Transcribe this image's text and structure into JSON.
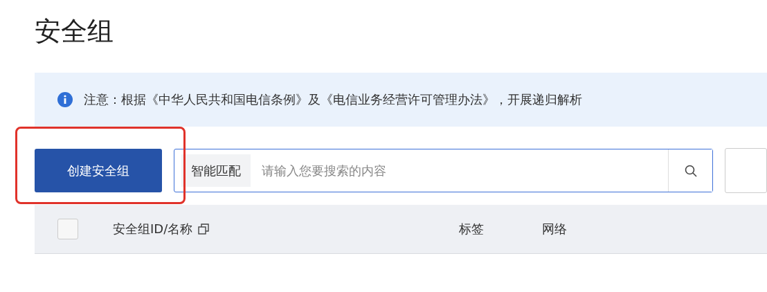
{
  "page_title": "安全组",
  "notice": {
    "text": "注意：根据《中华人民共和国电信条例》及《电信业务经营许可管理办法》，开展递归解析"
  },
  "toolbar": {
    "create_button": "创建安全组",
    "highlighted": true,
    "search": {
      "mode": "智能匹配",
      "placeholder": "请输入您要搜索的内容"
    }
  },
  "table": {
    "select_all_checked": false,
    "columns": [
      {
        "label": "安全组ID/名称",
        "copyable": true
      },
      {
        "label": "标签",
        "copyable": false
      },
      {
        "label": "网络",
        "copyable": false
      }
    ]
  }
}
